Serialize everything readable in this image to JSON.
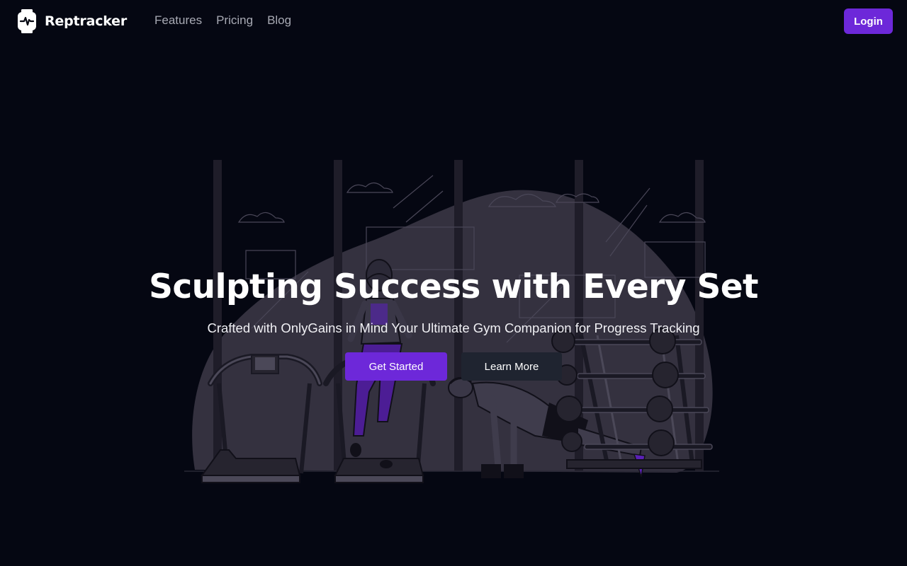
{
  "brand": {
    "name": "Reptracker",
    "icon": "smartwatch-icon"
  },
  "nav": {
    "links": [
      "Features",
      "Pricing",
      "Blog"
    ],
    "login_label": "Login"
  },
  "hero": {
    "title": "Sculpting Success with Every Set",
    "subtitle": "Crafted with OnlyGains in Mind Your Ultimate Gym Companion for Progress Tracking",
    "primary_cta": "Get Started",
    "secondary_cta": "Learn More"
  },
  "illustration": {
    "name": "gym-scene-illustration",
    "blob_color": "#34313f",
    "accent_color": "#5b21b6"
  },
  "colors": {
    "background": "#050712",
    "accent": "#6d28d9",
    "secondary_button": "#1f2430",
    "nav_link": "#a8aab4"
  }
}
